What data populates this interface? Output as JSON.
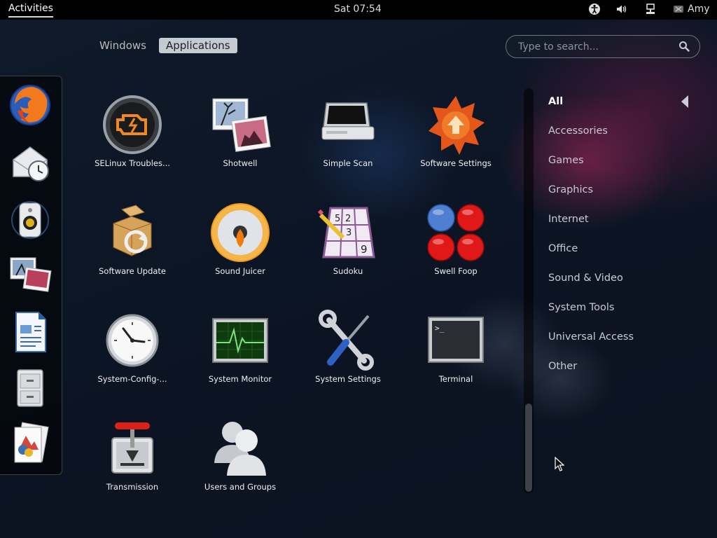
{
  "topbar": {
    "activities": "Activities",
    "clock": "Sat 07:54",
    "user": "Amy",
    "icons": [
      "accessibility-icon",
      "volume-icon",
      "network-icon",
      "user-icon"
    ]
  },
  "view_toggle": {
    "windows": "Windows",
    "applications": "Applications",
    "selected": "Applications"
  },
  "search": {
    "placeholder": "Type to search..."
  },
  "dash": {
    "items": [
      "firefox-icon",
      "evolution-icon",
      "rhythmbox-icon",
      "shotwell-icon",
      "libreoffice-writer-icon",
      "file-manager-icon",
      "document-viewer-icon"
    ]
  },
  "apps": [
    {
      "label": "SELinux Troubles...",
      "icon": "selinux-troubleshooter-icon"
    },
    {
      "label": "Shotwell",
      "icon": "shotwell-icon"
    },
    {
      "label": "Simple Scan",
      "icon": "scanner-icon"
    },
    {
      "label": "Software Settings",
      "icon": "software-settings-icon"
    },
    {
      "label": "Software Update",
      "icon": "software-update-icon"
    },
    {
      "label": "Sound Juicer",
      "icon": "sound-juicer-icon"
    },
    {
      "label": "Sudoku",
      "icon": "sudoku-icon"
    },
    {
      "label": "Swell Foop",
      "icon": "swell-foop-icon"
    },
    {
      "label": "System-Config-...",
      "icon": "clock-icon"
    },
    {
      "label": "System Monitor",
      "icon": "system-monitor-icon"
    },
    {
      "label": "System Settings",
      "icon": "system-settings-icon"
    },
    {
      "label": "Terminal",
      "icon": "terminal-icon"
    },
    {
      "label": "Transmission",
      "icon": "transmission-icon"
    },
    {
      "label": "Users and Groups",
      "icon": "users-groups-icon"
    }
  ],
  "sudoku_digits": [
    "5",
    "2",
    "3",
    "9"
  ],
  "terminal_prompt": ">_",
  "categories": [
    {
      "label": "All",
      "active": true
    },
    {
      "label": "Accessories"
    },
    {
      "label": "Games"
    },
    {
      "label": "Graphics"
    },
    {
      "label": "Internet"
    },
    {
      "label": "Office"
    },
    {
      "label": "Sound & Video"
    },
    {
      "label": "System Tools"
    },
    {
      "label": "Universal Access"
    },
    {
      "label": "Other"
    }
  ]
}
